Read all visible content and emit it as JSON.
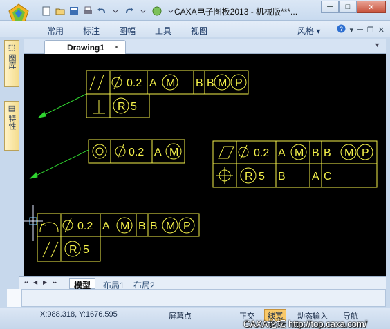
{
  "window": {
    "title": "CAXA电子图板2013 - 机械版***...",
    "buttons": [
      "─",
      "□",
      "✕"
    ]
  },
  "quick_access": [
    "new-icon",
    "open-icon",
    "save-icon",
    "print-icon",
    "undo-icon",
    "redo-icon",
    "globe-icon"
  ],
  "menu": {
    "items": [
      "常用",
      "标注",
      "图幅",
      "工具",
      "视图"
    ],
    "style_label": "风格",
    "right_icons": [
      "help-icon",
      "minimize-icon",
      "restore-icon",
      "close-icon"
    ]
  },
  "left_panel": {
    "tabs": [
      "图库",
      "特性"
    ]
  },
  "document_tab": {
    "label": "Drawing1",
    "close": "×"
  },
  "layout_tabs": [
    "模型",
    "布局1",
    "布局2"
  ],
  "fcfs": [
    {
      "rows": [
        [
          "⫽",
          "⌀0.2",
          "Ⓐ Ⓜ",
          "B",
          "BⓂⓅ"
        ],
        [
          "⊥",
          "Ⓡ5"
        ]
      ]
    },
    {
      "rows": [
        [
          "◎",
          "⌀0.2",
          "Ⓐ Ⓜ"
        ]
      ]
    },
    {
      "rows": [
        [
          "▱",
          "⌀0.2",
          "Ⓐ Ⓜ",
          "B",
          "BⓂⓅ"
        ],
        [
          "⌖",
          "Ⓡ5",
          "B",
          "A C"
        ]
      ]
    },
    {
      "rows": [
        [
          "⌒",
          "⌀0.2",
          "Ⓐ Ⓜ",
          "B",
          "BⓂⓅ"
        ],
        [
          "//",
          "Ⓡ5"
        ]
      ]
    }
  ],
  "canvas_text": {
    "a": "A",
    "b": "B",
    "c": "C",
    "v02": "0.2",
    "v5": "5",
    "r": "R",
    "m": "M",
    "p": "P"
  },
  "colors": {
    "annotation": "#f4f14a",
    "leader": "#2fd42f",
    "canvas": "#000000"
  },
  "status": {
    "coords": "X:988.318, Y:1676.595",
    "screen_point": "屏幕点",
    "ortho": "正交",
    "linewidth": "线宽",
    "dynamic_input": "动态输入",
    "navigation": "导航"
  },
  "watermark": "CAXA论坛 http://top.caxa.com/"
}
